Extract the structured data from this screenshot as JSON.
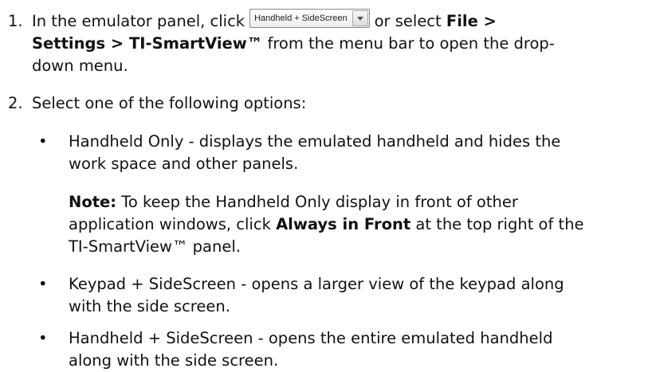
{
  "steps": [
    {
      "number": "1.",
      "text_before": "In the emulator panel, click",
      "dropdown_label": "Handheld + SideScreen",
      "text_after": "or select",
      "bold_menu": "File >",
      "line2_bold": "Settings > TI-SmartView™",
      "line2_text": " from the menu bar to open the drop-",
      "line3_text": "down menu."
    },
    {
      "number": "2.",
      "text": "Select one of the following options:"
    }
  ],
  "bullet_char": "•",
  "options": [
    {
      "line1": "Handheld Only - displays the emulated handheld and hides the",
      "line2": "work space and other panels."
    },
    {
      "line1": "Keypad + SideScreen - opens a larger view of the keypad along",
      "line2": "with the side screen."
    },
    {
      "line1": "Handheld + SideScreen - opens the entire emulated handheld",
      "line2": "along with the side screen."
    }
  ],
  "note": {
    "label": "Note:",
    "line1_text": " To keep the Handheld Only display in front of other",
    "line2_text_before": "application windows, click ",
    "line2_bold": "Always in Front",
    "line2_text_after": " at the top right of the",
    "line3_text": "TI-SmartView™ panel."
  }
}
